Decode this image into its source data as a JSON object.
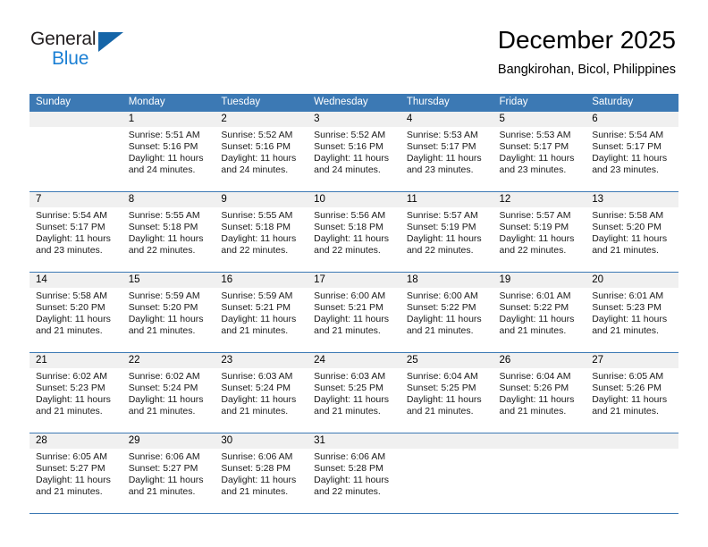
{
  "logo": {
    "word_top": "General",
    "word_bottom": "Blue",
    "triangle_color": "#1565a8",
    "blue_text_color": "#1a7fd4"
  },
  "header": {
    "title": "December 2025",
    "subtitle": "Bangkirohan, Bicol, Philippines"
  },
  "theme": {
    "header_blue": "#3c79b4",
    "row_border_blue": "#3c79b4",
    "daynum_band": "#f0f0f0"
  },
  "weekdays": [
    "Sunday",
    "Monday",
    "Tuesday",
    "Wednesday",
    "Thursday",
    "Friday",
    "Saturday"
  ],
  "labels": {
    "sunrise_prefix": "Sunrise:",
    "sunset_prefix": "Sunset:",
    "daylight_prefix": "Daylight:"
  },
  "weeks": [
    [
      {
        "day": "",
        "sunrise": "",
        "sunset": "",
        "daylight": "",
        "empty": true
      },
      {
        "day": "1",
        "sunrise": "Sunrise: 5:51 AM",
        "sunset": "Sunset: 5:16 PM",
        "daylight": "Daylight: 11 hours and 24 minutes."
      },
      {
        "day": "2",
        "sunrise": "Sunrise: 5:52 AM",
        "sunset": "Sunset: 5:16 PM",
        "daylight": "Daylight: 11 hours and 24 minutes."
      },
      {
        "day": "3",
        "sunrise": "Sunrise: 5:52 AM",
        "sunset": "Sunset: 5:16 PM",
        "daylight": "Daylight: 11 hours and 24 minutes."
      },
      {
        "day": "4",
        "sunrise": "Sunrise: 5:53 AM",
        "sunset": "Sunset: 5:17 PM",
        "daylight": "Daylight: 11 hours and 23 minutes."
      },
      {
        "day": "5",
        "sunrise": "Sunrise: 5:53 AM",
        "sunset": "Sunset: 5:17 PM",
        "daylight": "Daylight: 11 hours and 23 minutes."
      },
      {
        "day": "6",
        "sunrise": "Sunrise: 5:54 AM",
        "sunset": "Sunset: 5:17 PM",
        "daylight": "Daylight: 11 hours and 23 minutes."
      }
    ],
    [
      {
        "day": "7",
        "sunrise": "Sunrise: 5:54 AM",
        "sunset": "Sunset: 5:17 PM",
        "daylight": "Daylight: 11 hours and 23 minutes."
      },
      {
        "day": "8",
        "sunrise": "Sunrise: 5:55 AM",
        "sunset": "Sunset: 5:18 PM",
        "daylight": "Daylight: 11 hours and 22 minutes."
      },
      {
        "day": "9",
        "sunrise": "Sunrise: 5:55 AM",
        "sunset": "Sunset: 5:18 PM",
        "daylight": "Daylight: 11 hours and 22 minutes."
      },
      {
        "day": "10",
        "sunrise": "Sunrise: 5:56 AM",
        "sunset": "Sunset: 5:18 PM",
        "daylight": "Daylight: 11 hours and 22 minutes."
      },
      {
        "day": "11",
        "sunrise": "Sunrise: 5:57 AM",
        "sunset": "Sunset: 5:19 PM",
        "daylight": "Daylight: 11 hours and 22 minutes."
      },
      {
        "day": "12",
        "sunrise": "Sunrise: 5:57 AM",
        "sunset": "Sunset: 5:19 PM",
        "daylight": "Daylight: 11 hours and 22 minutes."
      },
      {
        "day": "13",
        "sunrise": "Sunrise: 5:58 AM",
        "sunset": "Sunset: 5:20 PM",
        "daylight": "Daylight: 11 hours and 21 minutes."
      }
    ],
    [
      {
        "day": "14",
        "sunrise": "Sunrise: 5:58 AM",
        "sunset": "Sunset: 5:20 PM",
        "daylight": "Daylight: 11 hours and 21 minutes."
      },
      {
        "day": "15",
        "sunrise": "Sunrise: 5:59 AM",
        "sunset": "Sunset: 5:20 PM",
        "daylight": "Daylight: 11 hours and 21 minutes."
      },
      {
        "day": "16",
        "sunrise": "Sunrise: 5:59 AM",
        "sunset": "Sunset: 5:21 PM",
        "daylight": "Daylight: 11 hours and 21 minutes."
      },
      {
        "day": "17",
        "sunrise": "Sunrise: 6:00 AM",
        "sunset": "Sunset: 5:21 PM",
        "daylight": "Daylight: 11 hours and 21 minutes."
      },
      {
        "day": "18",
        "sunrise": "Sunrise: 6:00 AM",
        "sunset": "Sunset: 5:22 PM",
        "daylight": "Daylight: 11 hours and 21 minutes."
      },
      {
        "day": "19",
        "sunrise": "Sunrise: 6:01 AM",
        "sunset": "Sunset: 5:22 PM",
        "daylight": "Daylight: 11 hours and 21 minutes."
      },
      {
        "day": "20",
        "sunrise": "Sunrise: 6:01 AM",
        "sunset": "Sunset: 5:23 PM",
        "daylight": "Daylight: 11 hours and 21 minutes."
      }
    ],
    [
      {
        "day": "21",
        "sunrise": "Sunrise: 6:02 AM",
        "sunset": "Sunset: 5:23 PM",
        "daylight": "Daylight: 11 hours and 21 minutes."
      },
      {
        "day": "22",
        "sunrise": "Sunrise: 6:02 AM",
        "sunset": "Sunset: 5:24 PM",
        "daylight": "Daylight: 11 hours and 21 minutes."
      },
      {
        "day": "23",
        "sunrise": "Sunrise: 6:03 AM",
        "sunset": "Sunset: 5:24 PM",
        "daylight": "Daylight: 11 hours and 21 minutes."
      },
      {
        "day": "24",
        "sunrise": "Sunrise: 6:03 AM",
        "sunset": "Sunset: 5:25 PM",
        "daylight": "Daylight: 11 hours and 21 minutes."
      },
      {
        "day": "25",
        "sunrise": "Sunrise: 6:04 AM",
        "sunset": "Sunset: 5:25 PM",
        "daylight": "Daylight: 11 hours and 21 minutes."
      },
      {
        "day": "26",
        "sunrise": "Sunrise: 6:04 AM",
        "sunset": "Sunset: 5:26 PM",
        "daylight": "Daylight: 11 hours and 21 minutes."
      },
      {
        "day": "27",
        "sunrise": "Sunrise: 6:05 AM",
        "sunset": "Sunset: 5:26 PM",
        "daylight": "Daylight: 11 hours and 21 minutes."
      }
    ],
    [
      {
        "day": "28",
        "sunrise": "Sunrise: 6:05 AM",
        "sunset": "Sunset: 5:27 PM",
        "daylight": "Daylight: 11 hours and 21 minutes."
      },
      {
        "day": "29",
        "sunrise": "Sunrise: 6:06 AM",
        "sunset": "Sunset: 5:27 PM",
        "daylight": "Daylight: 11 hours and 21 minutes."
      },
      {
        "day": "30",
        "sunrise": "Sunrise: 6:06 AM",
        "sunset": "Sunset: 5:28 PM",
        "daylight": "Daylight: 11 hours and 21 minutes."
      },
      {
        "day": "31",
        "sunrise": "Sunrise: 6:06 AM",
        "sunset": "Sunset: 5:28 PM",
        "daylight": "Daylight: 11 hours and 22 minutes."
      },
      {
        "day": "",
        "sunrise": "",
        "sunset": "",
        "daylight": "",
        "empty": true
      },
      {
        "day": "",
        "sunrise": "",
        "sunset": "",
        "daylight": "",
        "empty": true
      },
      {
        "day": "",
        "sunrise": "",
        "sunset": "",
        "daylight": "",
        "empty": true
      }
    ]
  ]
}
